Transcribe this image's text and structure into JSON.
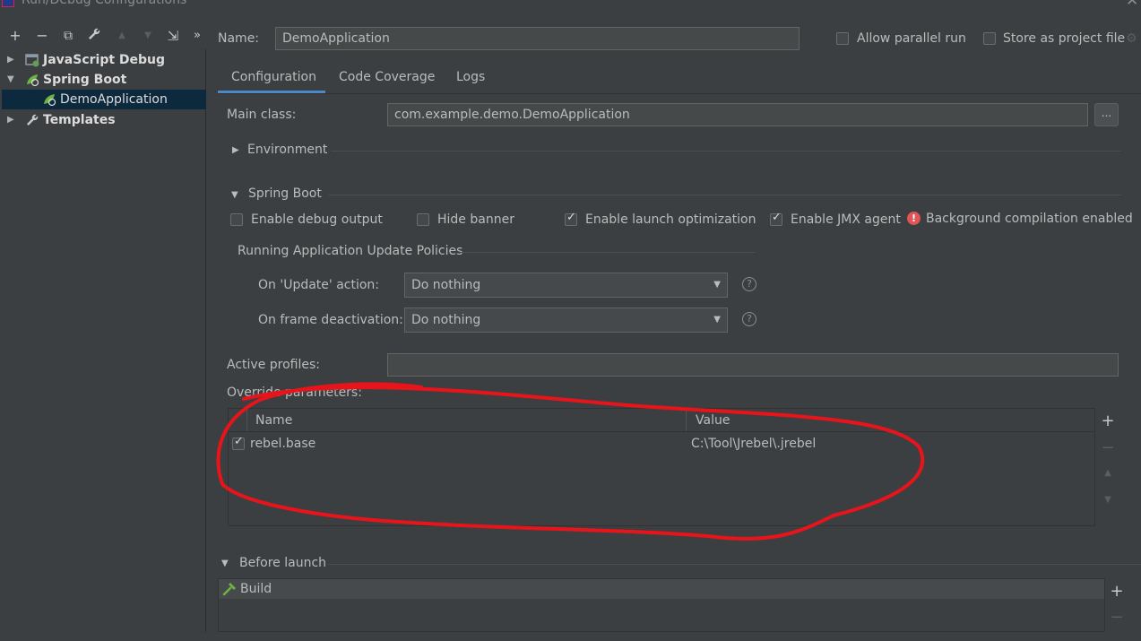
{
  "window": {
    "title": "Run/Debug Configurations"
  },
  "toolbar": {
    "add": "+",
    "remove": "−",
    "copy": "⧉",
    "edit": "🔧",
    "up": "▲",
    "down": "▼",
    "move": "⇲",
    "more": "»"
  },
  "tree": [
    {
      "label": "JavaScript Debug",
      "icon": "javascript-debug-icon",
      "expanded": false
    },
    {
      "label": "Spring Boot",
      "icon": "spring-boot-icon",
      "expanded": true
    },
    {
      "label": "DemoApplication",
      "icon": "spring-boot-app-icon",
      "selected": true
    },
    {
      "label": "Templates",
      "icon": "wrench-icon",
      "expanded": false
    }
  ],
  "name_row": {
    "label": "Name:",
    "value": "DemoApplication",
    "allow_parallel": {
      "label": "Allow parallel run",
      "checked": false
    },
    "store_as_file": {
      "label": "Store as project file",
      "checked": false
    }
  },
  "tabs": [
    "Configuration",
    "Code Coverage",
    "Logs"
  ],
  "main_class": {
    "label": "Main class:",
    "value": "com.example.demo.DemoApplication",
    "browse": "..."
  },
  "environment": {
    "label": "Environment"
  },
  "spring_boot": {
    "label": "Spring Boot",
    "enable_debug": {
      "label": "Enable debug output",
      "checked": false
    },
    "hide_banner": {
      "label": "Hide banner",
      "checked": false
    },
    "launch_opt": {
      "label": "Enable launch optimization",
      "checked": true
    },
    "jmx": {
      "label": "Enable JMX agent",
      "checked": true
    },
    "bg_compile": "Background compilation enabled"
  },
  "policies": {
    "title": "Running Application Update Policies",
    "update_label": "On 'Update' action:",
    "update_value": "Do nothing",
    "frame_label": "On frame deactivation:",
    "frame_value": "Do nothing",
    "help": "?"
  },
  "active_profiles": {
    "label": "Active profiles:",
    "value": ""
  },
  "override": {
    "label": "Override parameters:",
    "columns": [
      "Name",
      "Value"
    ],
    "rows": [
      {
        "checked": true,
        "name": "rebel.base",
        "value": "C:\\Tool\\Jrebel\\.jrebel"
      }
    ],
    "add": "+",
    "remove": "−",
    "up": "▲",
    "down": "▼"
  },
  "before_launch": {
    "label": "Before launch",
    "items": [
      "Build"
    ],
    "add": "+",
    "remove": "−"
  },
  "annotation": {
    "color": "#e8141c"
  },
  "colors": {
    "background": "#3c3f41",
    "selection": "#0d293e",
    "accent": "#4a88c7",
    "error": "#e05555"
  }
}
